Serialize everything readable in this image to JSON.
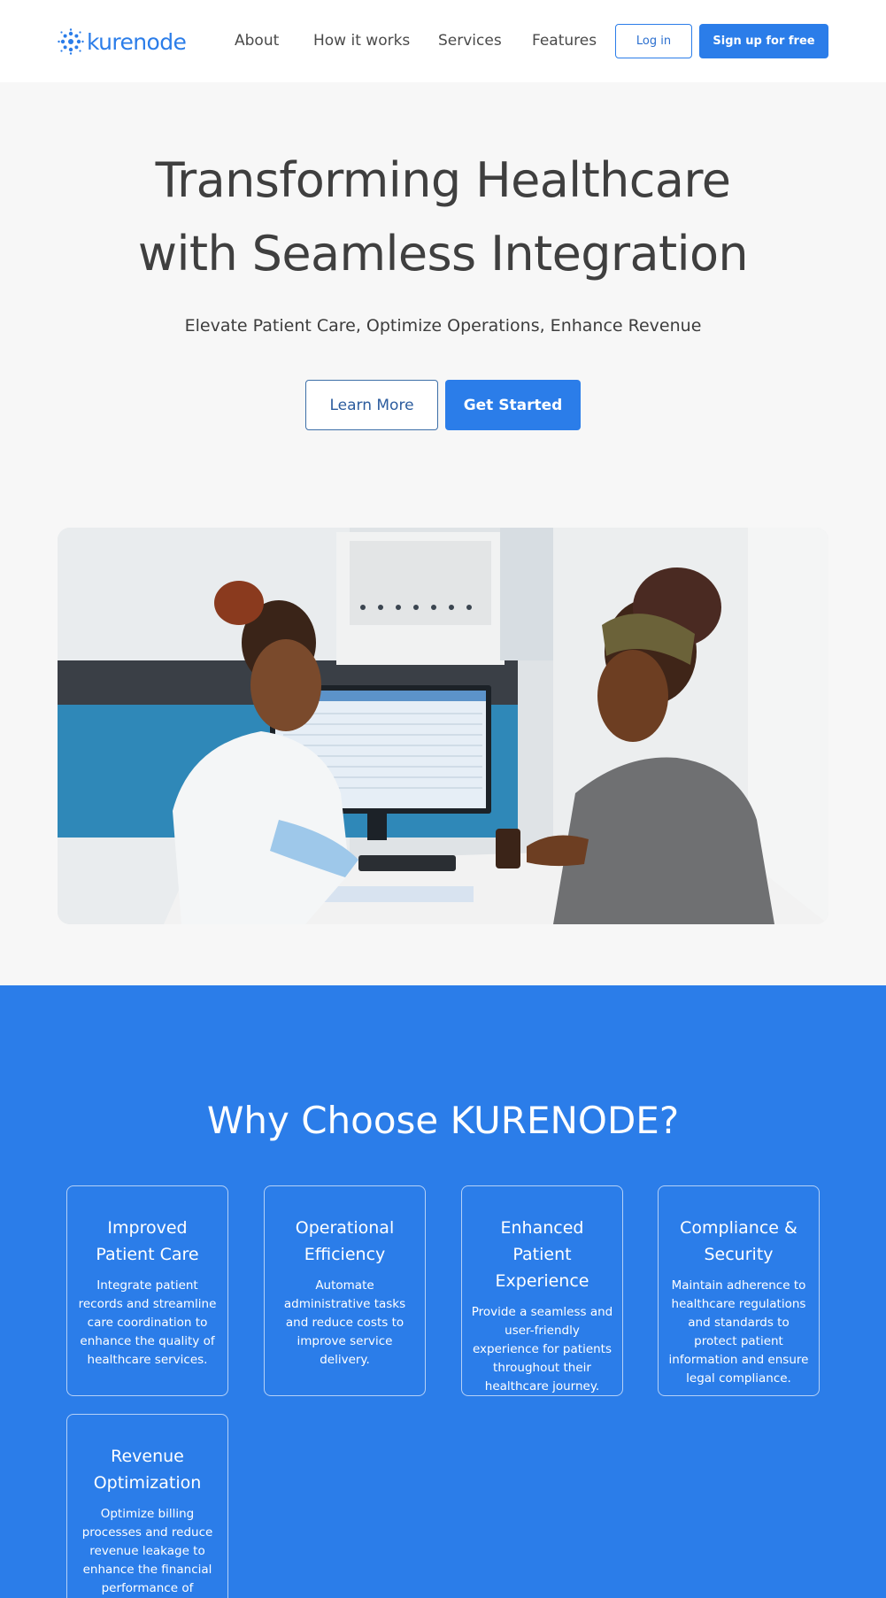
{
  "nav": {
    "logo_text": "kurenode",
    "links": [
      "About",
      "How it works",
      "Services",
      "Features"
    ],
    "login_label": "Log in",
    "signup_label": "Sign up for free"
  },
  "hero": {
    "title_line1": "Transforming Healthcare",
    "title_line2": "with Seamless Integration",
    "subtitle": "Elevate Patient Care, Optimize Operations, Enhance Revenue",
    "learn_more_label": "Learn More",
    "get_started_label": "Get Started"
  },
  "why": {
    "title": "Why Choose KURENODE?",
    "cards": [
      {
        "title": "Improved Patient Care",
        "text": "Integrate patient records and streamline care coordination to enhance the quality of healthcare services."
      },
      {
        "title": "Operational Efficiency",
        "text": "Automate administrative tasks and reduce costs to improve service delivery."
      },
      {
        "title": "Enhanced Patient Experience",
        "text": "Provide a seamless and user-friendly experience for patients throughout their healthcare journey."
      },
      {
        "title": "Compliance & Security",
        "text": "Maintain adherence to healthcare regulations and standards to protect patient information and ensure legal compliance."
      },
      {
        "title": "Revenue Optimization",
        "text": "Optimize billing processes and reduce revenue leakage to enhance the financial performance of"
      }
    ]
  },
  "colors": {
    "accent": "#2b7de9",
    "text": "#3d3d3d",
    "background": "#f7f7f7"
  }
}
